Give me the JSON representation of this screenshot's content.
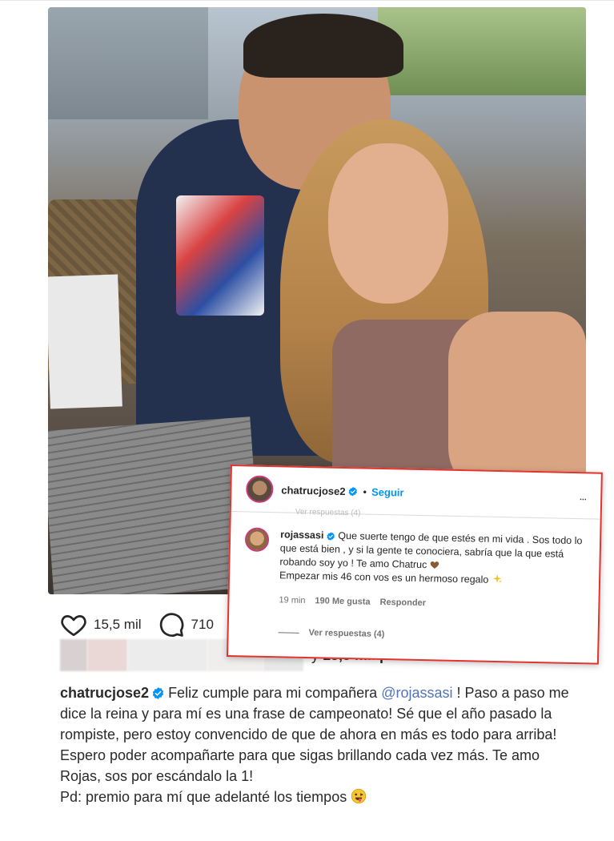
{
  "post": {
    "like_count": "15,5 mil",
    "comment_count": "710",
    "likes_suffix_connector": "y",
    "likes_suffix_bold": "15,5 mil personas más",
    "caption": {
      "username": "chatrucjose2",
      "text_before_mention": "Feliz cumple para mi compañera",
      "mention": "@rojassasi",
      "text_after_mention": "! Paso a paso me dice la reina y para mí es una frase de campeonato! Sé que el año pasado la rompiste, pero estoy convencido de que de ahora en más es todo para arriba! Espero poder acompañarte para que sigas brillando cada vez más. Te amo Rojas, sos por escándalo la 1!",
      "ps": "Pd: premio para mí que adelanté los tiempos"
    }
  },
  "overlay": {
    "header_username": "chatrucjose2",
    "separator": "•",
    "follow_label": "Seguir",
    "more_label": "...",
    "faded_text": "Ver respuestas (4)",
    "comment": {
      "username": "rojassasi",
      "text_part1": "Que suerte tengo de que estés en mi vida . Sos todo lo que está bien , y si la gente te conociera, sabría que la que está robando soy yo ! Te amo Chatruc",
      "text_part2": "Empezar mis 46 con vos es un hermoso regalo",
      "time": "19 min",
      "likes": "190 Me gusta",
      "reply_label": "Responder"
    },
    "view_replies": "Ver respuestas (4)"
  },
  "colors": {
    "verified": "#0095f6",
    "mention": "#5474b8",
    "overlay_border": "#e2332d",
    "follow": "#0095f6"
  },
  "icons": [
    "heart-icon",
    "comment-icon",
    "verified-badge-icon",
    "emoji-tongue-icon",
    "emoji-sparkle-icon"
  ]
}
